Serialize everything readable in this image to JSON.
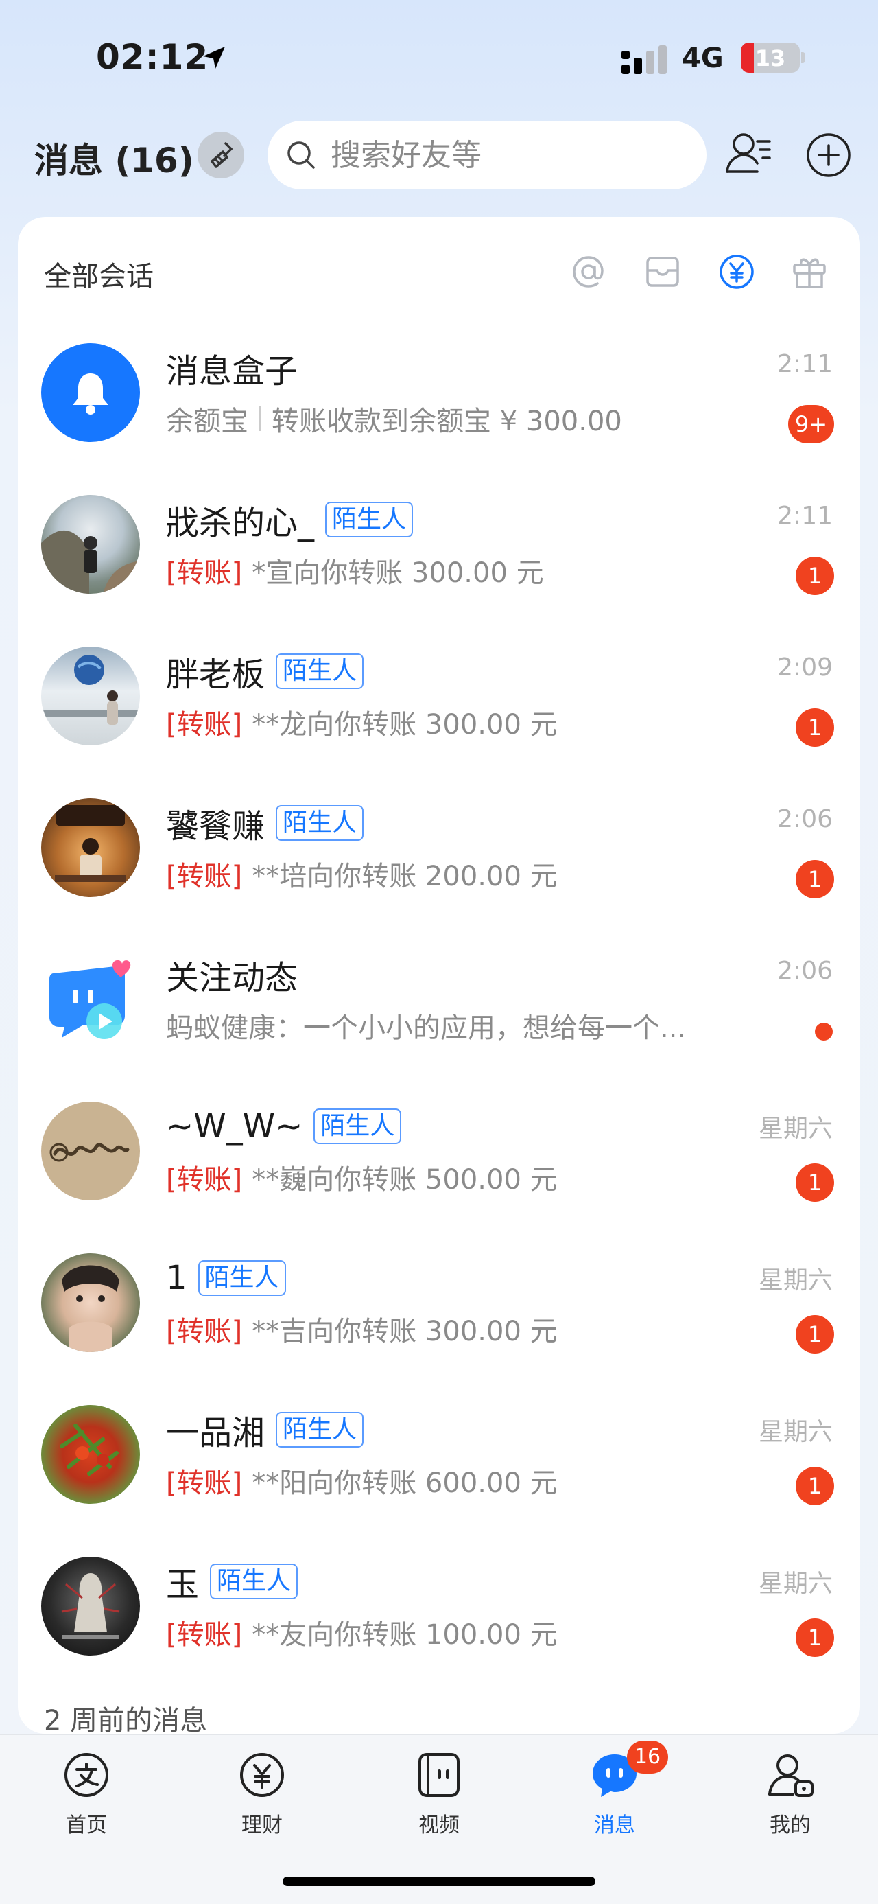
{
  "status_bar": {
    "time": "02:12",
    "network": "4G",
    "battery": "13",
    "battery_level": 0.13
  },
  "header": {
    "title": "消息 (16)",
    "search_placeholder": "搜索好友等"
  },
  "filter": {
    "label": "全部会话",
    "icons": [
      "at-icon",
      "card-icon",
      "yuan-icon",
      "gift-icon"
    ]
  },
  "conversations": [
    {
      "name": "消息盒子",
      "tag": "",
      "preview_prefix": "",
      "source": "余额宝",
      "preview": "转账收款到余额宝 ¥ 300.00",
      "time": "2:11",
      "badge": "9+"
    },
    {
      "name": "戕杀的心_",
      "tag": "陌生人",
      "preview_prefix": "[转账]",
      "preview": "*宣向你转账 300.00 元",
      "time": "2:11",
      "badge": "1"
    },
    {
      "name": "胖老板",
      "tag": "陌生人",
      "preview_prefix": "[转账]",
      "preview": "**龙向你转账 300.00 元",
      "time": "2:09",
      "badge": "1"
    },
    {
      "name": "饕餮赚",
      "tag": "陌生人",
      "preview_prefix": "[转账]",
      "preview": "**培向你转账 200.00 元",
      "time": "2:06",
      "badge": "1"
    },
    {
      "name": "关注动态",
      "tag": "",
      "preview_prefix": "",
      "preview": "蚂蚁健康：一个小小的应用，想给每一个...",
      "time": "2:06",
      "badge": ""
    },
    {
      "name": "~W_W~",
      "tag": "陌生人",
      "preview_prefix": "[转账]",
      "preview": "**巍向你转账 500.00 元",
      "time": "星期六",
      "badge": "1"
    },
    {
      "name": "1",
      "tag": "陌生人",
      "preview_prefix": "[转账]",
      "preview": "**吉向你转账 300.00 元",
      "time": "星期六",
      "badge": "1"
    },
    {
      "name": "一品湘",
      "tag": "陌生人",
      "preview_prefix": "[转账]",
      "preview": "**阳向你转账 600.00 元",
      "time": "星期六",
      "badge": "1"
    },
    {
      "name": "玉",
      "tag": "陌生人",
      "preview_prefix": "[转账]",
      "preview": "**友向你转账 100.00 元",
      "time": "星期六",
      "badge": "1"
    }
  ],
  "section_title": "2 周前的消息",
  "tabs": [
    {
      "label": "首页",
      "icon": "alipay-home-icon"
    },
    {
      "label": "理财",
      "icon": "finance-icon"
    },
    {
      "label": "视频",
      "icon": "video-icon"
    },
    {
      "label": "消息",
      "icon": "message-icon",
      "badge": "16",
      "active": true
    },
    {
      "label": "我的",
      "icon": "profile-icon"
    }
  ],
  "colors": {
    "accent": "#1677ff",
    "badge": "#f0421f",
    "transfer_red": "#e0322a"
  }
}
